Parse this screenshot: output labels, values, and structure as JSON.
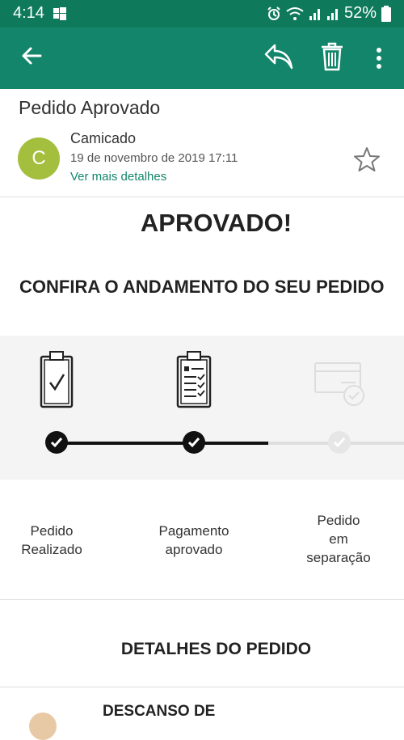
{
  "status_bar": {
    "time": "4:14",
    "battery": "52%"
  },
  "email": {
    "subject": "Pedido Aprovado",
    "sender_initial": "C",
    "sender": "Camicado",
    "date": "19 de novembro de 2019 17:11",
    "details_link": "Ver mais detalhes"
  },
  "body": {
    "headline": "APROVADO!",
    "progress_title": "CONFIRA O ANDAMENTO DO SEU PEDIDO",
    "steps": [
      {
        "label_line1": "Pedido",
        "label_line2": "Realizado",
        "label_line3": "",
        "state": "done"
      },
      {
        "label_line1": "Pagamento",
        "label_line2": "aprovado",
        "label_line3": "",
        "state": "done"
      },
      {
        "label_line1": "Pedido",
        "label_line2": "em",
        "label_line3": "separação",
        "state": "pending"
      }
    ],
    "details_title": "DETALHES DO PEDIDO",
    "product_name": "DESCANSO DE"
  },
  "colors": {
    "status_bar": "#0e7a5b",
    "app_bar": "#13856a",
    "avatar": "#a4be3e",
    "link": "#13856a"
  },
  "icons": [
    "back-arrow-icon",
    "reply-icon",
    "trash-icon",
    "more-vert-icon",
    "star-icon",
    "clipboard-check-icon",
    "clipboard-list-icon",
    "card-check-icon"
  ]
}
